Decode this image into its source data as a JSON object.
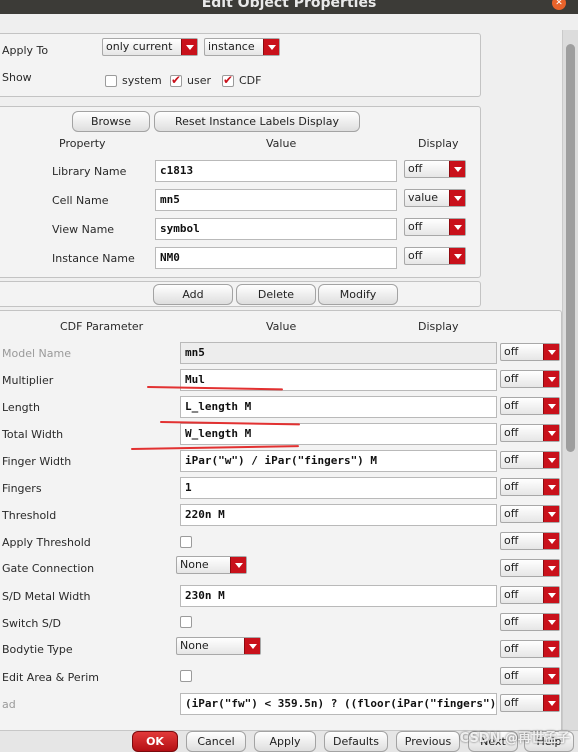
{
  "window": {
    "title": "Edit Object Properties",
    "close_icon": "close-icon"
  },
  "apply": {
    "apply_to_label": "Apply To",
    "apply_to_value": "only current",
    "apply_scope_value": "instance",
    "show_label": "Show",
    "system_label": "system",
    "system_checked": false,
    "user_label": "user",
    "user_checked": true,
    "cdf_label": "CDF",
    "cdf_checked": true
  },
  "instance": {
    "browse_label": "Browse",
    "reset_label": "Reset Instance Labels Display",
    "col_property": "Property",
    "col_value": "Value",
    "col_display": "Display",
    "rows": [
      {
        "label": "Library Name",
        "value": "c1813",
        "display": "off"
      },
      {
        "label": "Cell Name",
        "value": "mn5",
        "display": "value"
      },
      {
        "label": "View Name",
        "value": "symbol",
        "display": "off"
      },
      {
        "label": "Instance Name",
        "value": "NM0",
        "display": "off"
      }
    ]
  },
  "actions": {
    "add_label": "Add",
    "delete_label": "Delete",
    "modify_label": "Modify"
  },
  "cdf": {
    "col_param": "CDF Parameter",
    "col_value": "Value",
    "col_display": "Display",
    "rows": [
      {
        "label": "Model Name",
        "value": "mn5",
        "display": "off"
      },
      {
        "label": "Multiplier",
        "value": "Mul",
        "display": "off"
      },
      {
        "label": "Length",
        "value": "L_length M",
        "display": "off"
      },
      {
        "label": "Total Width",
        "value": "W_length M",
        "display": "off"
      },
      {
        "label": "Finger Width",
        "value": "iPar(\"w\") / iPar(\"fingers\") M",
        "display": "off"
      },
      {
        "label": "Fingers",
        "value": "1",
        "display": "off"
      },
      {
        "label": "Threshold",
        "value": "220n M",
        "display": "off"
      },
      {
        "label": "Apply Threshold",
        "display": "off"
      },
      {
        "label": "Gate Connection",
        "value": "None",
        "display": "off"
      },
      {
        "label": "S/D Metal Width",
        "value": "230n M",
        "display": "off"
      },
      {
        "label": "Switch S/D",
        "display": "off"
      },
      {
        "label": "Bodytie Type",
        "value": "None",
        "display": "off"
      },
      {
        "label": "Edit Area & Perim",
        "display": "off"
      },
      {
        "label": "ad",
        "value": "(iPar(\"fw\") < 359.5n) ? ((floor(iPar(\"fingers\")",
        "display": "off"
      }
    ]
  },
  "footer": {
    "ok_label": "OK",
    "cancel_label": "Cancel",
    "apply_label": "Apply",
    "defaults_label": "Defaults",
    "previous_label": "Previous",
    "next_label": "Next",
    "help_label": "Help"
  },
  "watermark": "CSDN @再世孟子",
  "annotation_color": "#e23131"
}
